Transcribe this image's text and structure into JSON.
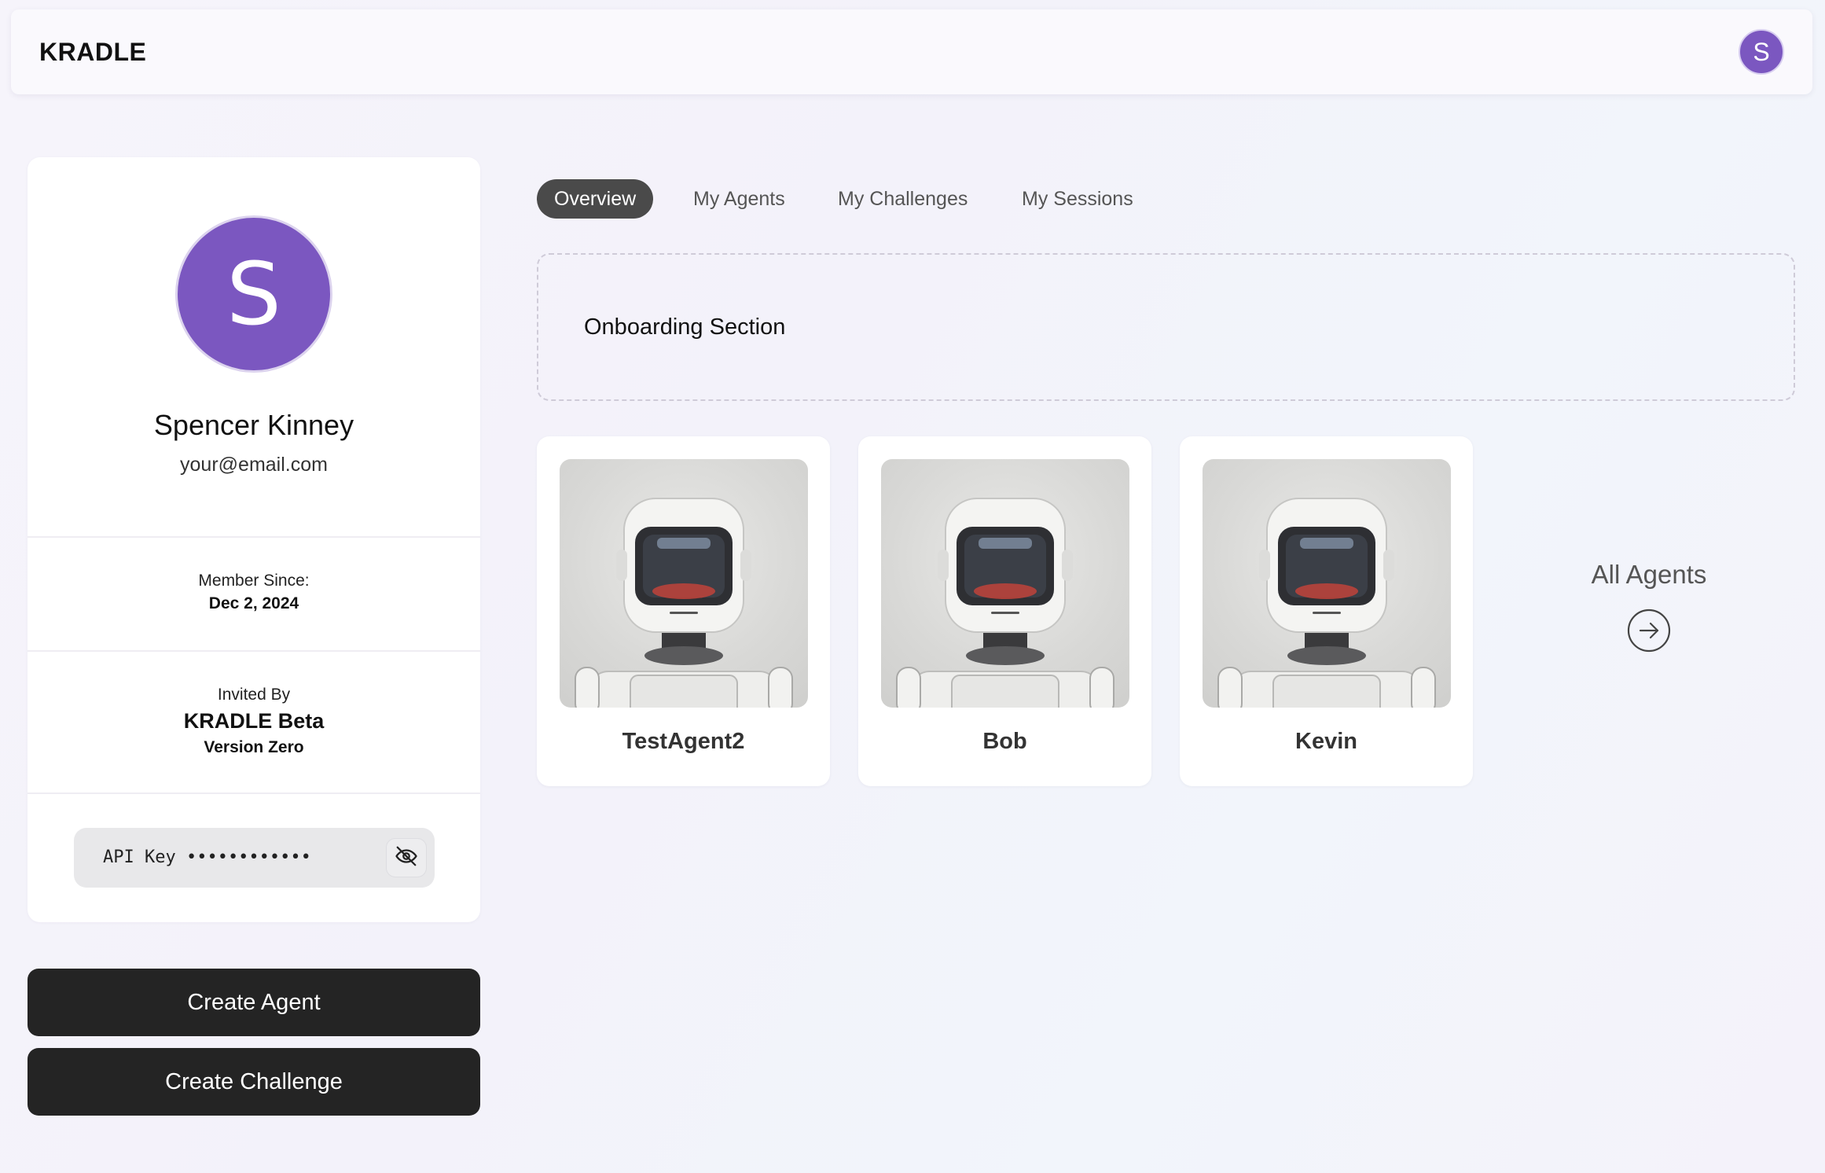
{
  "header": {
    "brand": "KRADLE",
    "avatar_initial": "S"
  },
  "profile": {
    "avatar_initial": "S",
    "name": "Spencer Kinney",
    "email": "your@email.com",
    "member_since_label": "Member Since:",
    "member_since_value": "Dec 2, 2024",
    "invited_by_label": "Invited By",
    "invited_by_name": "KRADLE Beta",
    "invited_by_sub": "Version Zero",
    "api_key_text": "API Key ••••••••••••",
    "api_toggle_icon": "eye-off-icon"
  },
  "actions": {
    "create_agent": "Create Agent",
    "create_challenge": "Create Challenge"
  },
  "tabs": [
    {
      "label": "Overview",
      "active": true
    },
    {
      "label": "My Agents",
      "active": false
    },
    {
      "label": "My Challenges",
      "active": false
    },
    {
      "label": "My Sessions",
      "active": false
    }
  ],
  "onboarding": {
    "title": "Onboarding Section"
  },
  "agents": [
    {
      "name": "TestAgent2",
      "image_icon": "robot-avatar"
    },
    {
      "name": "Bob",
      "image_icon": "robot-avatar"
    },
    {
      "name": "Kevin",
      "image_icon": "robot-avatar"
    }
  ],
  "all_agents": {
    "label": "All Agents",
    "icon": "arrow-right-circle-icon"
  },
  "colors": {
    "avatar_purple": "#7b57c0",
    "button_dark": "#242424",
    "tab_active": "#4a4a4a"
  }
}
